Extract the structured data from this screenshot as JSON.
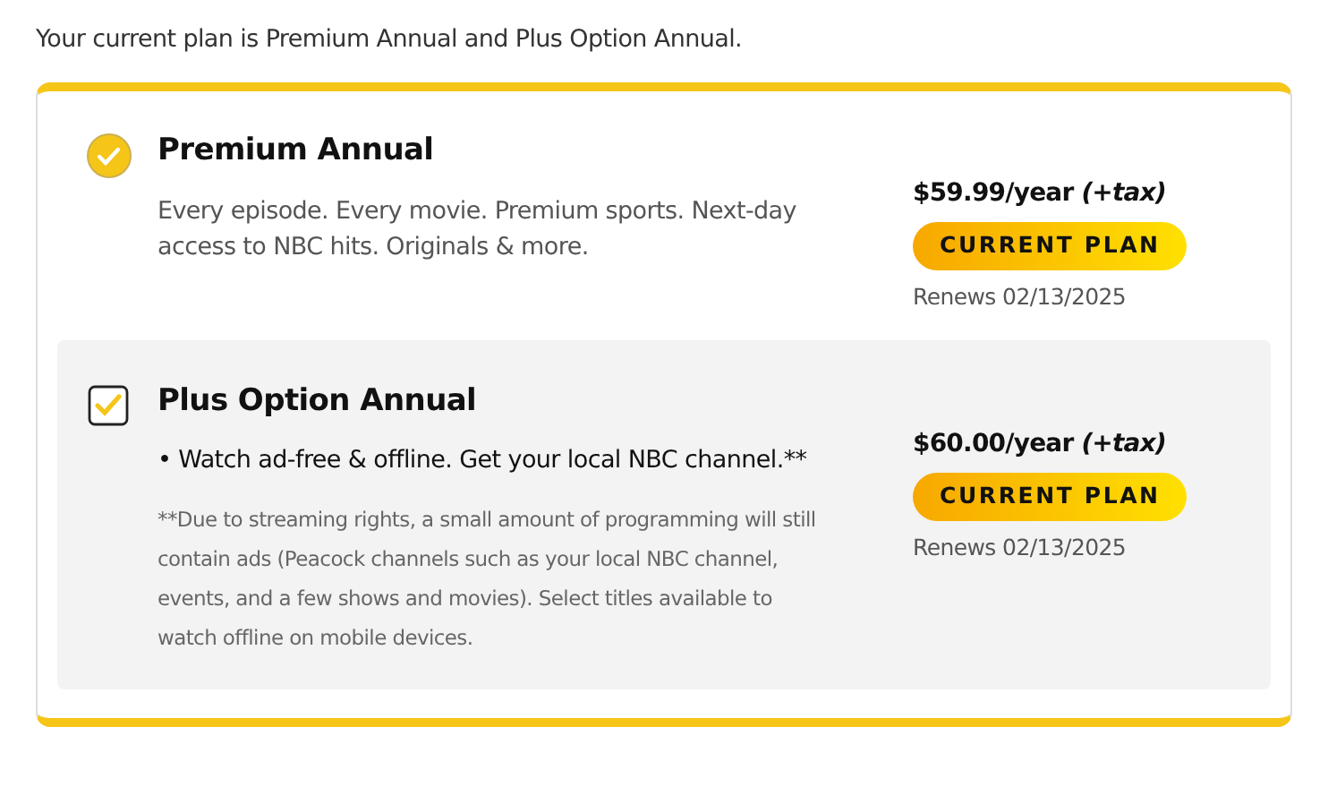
{
  "intro": "Your current plan is Premium Annual and Plus Option Annual.",
  "plans": [
    {
      "kind": "circle",
      "checked": true,
      "highlighted": false,
      "name": "Premium Annual",
      "description": "Every episode. Every movie. Premium sports. Next-day access to NBC hits. Originals & more.",
      "price": "$59.99/year *(+tax)*",
      "badge": "CURRENT PLAN",
      "renews": "Renews 02/13/2025"
    },
    {
      "kind": "checkbox",
      "checked": true,
      "highlighted": true,
      "name": "Plus Option Annual",
      "bullet": "•  Watch ad-free & offline. Get your local NBC channel.**",
      "footnote": "**Due to streaming rights, a small amount of programming will still contain ads (Peacock channels such as your local NBC channel, events, and a few shows and movies). Select titles available to watch offline on mobile devices.",
      "price": "$60.00/year *(+tax)*",
      "badge": "CURRENT PLAN",
      "renews": "Renews 02/13/2025"
    }
  ]
}
